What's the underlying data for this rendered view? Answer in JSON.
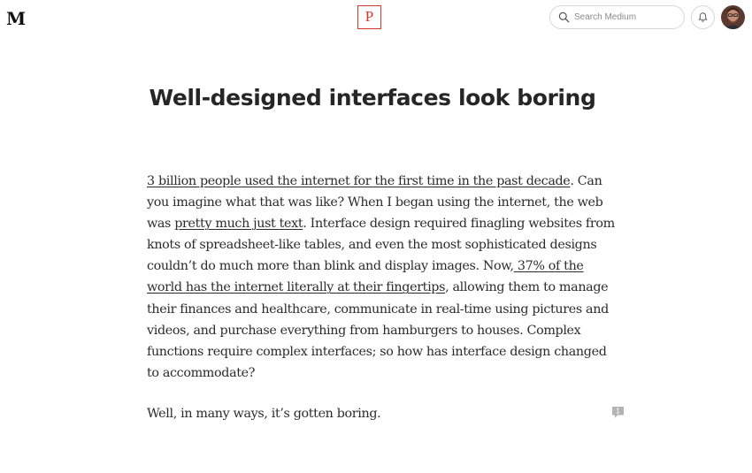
{
  "header": {
    "logo": "M",
    "publication_logo": "P",
    "search_placeholder": "Search Medium",
    "icons": {
      "search": "search-icon",
      "notifications": "bell-icon",
      "avatar": "user-avatar"
    }
  },
  "article": {
    "title": "Well-designed interfaces look boring",
    "paragraph1": {
      "l1_link": "3 billion people used the internet for the first time in the past decade",
      "l1_rest": ". Can",
      "l2": "you imagine what that was like? When I began using the internet, the web",
      "l3_pre": "was ",
      "l3_link": "pretty much just text",
      "l3_rest": ". Interface design required finagling websites from",
      "l4": "knots of spreadsheet-like tables, and even the most sophisticated designs",
      "l5_pre": "couldn’t do much more than blink and display images. Now,",
      "l5_link": " 37% of the",
      "l6_link": "world has the internet literally at their fingertips",
      "l6_rest": ", allowing them to manage",
      "l7": "their finances and healthcare, communicate in real-time using pictures and",
      "l8": "videos, and purchase everything from hamburgers to houses. Complex",
      "l9": "functions require complex interfaces; so how has interface design changed",
      "l10": "to accommodate?"
    },
    "paragraph2": "Well, in many ways, it’s gotten boring.",
    "comment_count": "1"
  },
  "colors": {
    "publication_accent": "#d8362b",
    "text": "#2b2b2b",
    "border": "#d6d6d6",
    "comment_badge": "#b3b3b3"
  }
}
